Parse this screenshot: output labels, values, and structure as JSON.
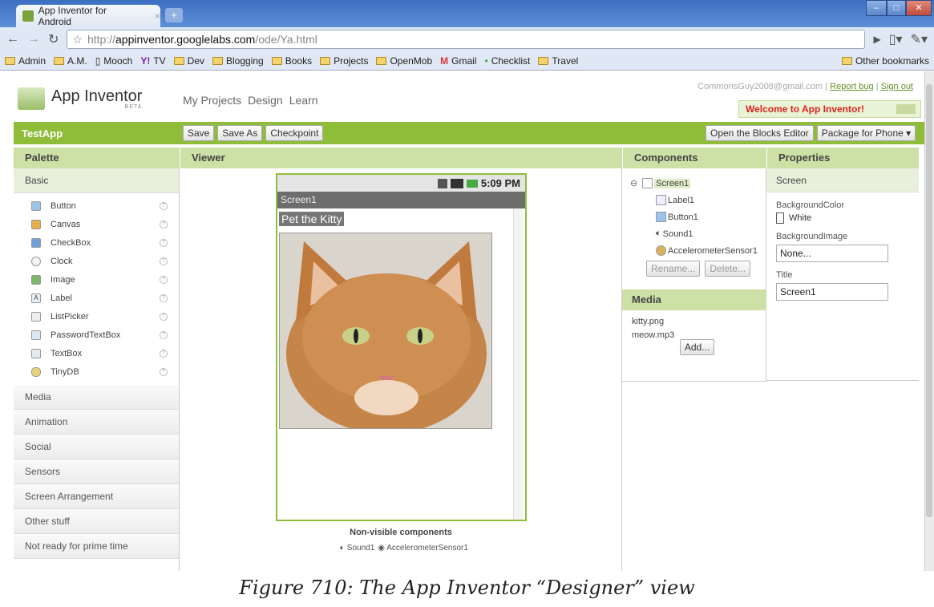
{
  "browser": {
    "tab_title": "App Inventor for Android",
    "tab_close": "×",
    "new_tab": "+",
    "url_prefix": "http://",
    "url_domain": "appinventor.googlelabs.com",
    "url_path": "/ode/Ya.html",
    "bookmarks": [
      "Admin",
      "A.M.",
      "Mooch",
      "TV",
      "Dev",
      "Blogging",
      "Books",
      "Projects",
      "OpenMob",
      "Gmail",
      "Checklist",
      "Travel"
    ],
    "other_bookmarks": "Other bookmarks"
  },
  "app": {
    "logo_title": "App Inventor",
    "logo_sub": "BETA",
    "nav": [
      "My Projects",
      "Design",
      "Learn"
    ],
    "account_email": "CommonsGuy2008@gmail.com",
    "report_bug": "Report bug",
    "sign_out": "Sign out",
    "welcome": "Welcome to App Inventor!",
    "project_name": "TestApp",
    "buttons": {
      "save": "Save",
      "save_as": "Save As",
      "checkpoint": "Checkpoint",
      "blocks_editor": "Open the Blocks Editor",
      "package": "Package for Phone ▾"
    }
  },
  "palette": {
    "header": "Palette",
    "basic": "Basic",
    "items": [
      "Button",
      "Canvas",
      "CheckBox",
      "Clock",
      "Image",
      "Label",
      "ListPicker",
      "PasswordTextBox",
      "TextBox",
      "TinyDB"
    ],
    "categories": [
      "Media",
      "Animation",
      "Social",
      "Sensors",
      "Screen Arrangement",
      "Other stuff",
      "Not ready for prime time"
    ]
  },
  "viewer": {
    "header": "Viewer",
    "time": "5:09 PM",
    "screen_title": "Screen1",
    "label_text": "Pet the Kitty",
    "non_visible": "Non-visible components",
    "non_visible_items": [
      "Sound1",
      "AccelerometerSensor1"
    ]
  },
  "components": {
    "header": "Components",
    "root": "Screen1",
    "children": [
      "Label1",
      "Button1",
      "Sound1",
      "AccelerometerSensor1"
    ],
    "rename": "Rename...",
    "delete": "Delete..."
  },
  "media": {
    "header": "Media",
    "files": [
      "kitty.png",
      "meow.mp3"
    ],
    "add": "Add..."
  },
  "properties": {
    "header": "Properties",
    "component": "Screen",
    "background_color_label": "BackgroundColor",
    "background_color_value": "White",
    "background_image_label": "BackgroundImage",
    "background_image_value": "None...",
    "title_label": "Title",
    "title_value": "Screen1"
  },
  "caption": "Figure 710: The App Inventor “Designer” view"
}
